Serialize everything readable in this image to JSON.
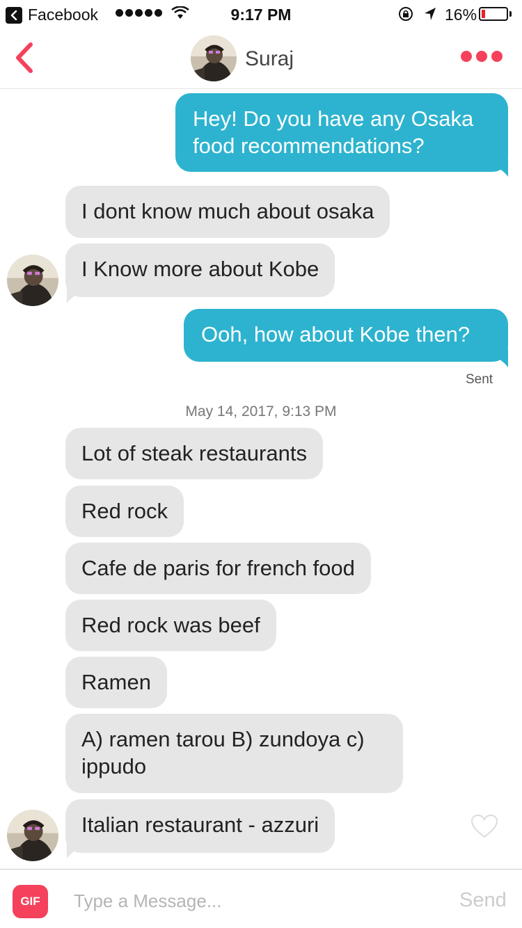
{
  "status_bar": {
    "back_app": "Facebook",
    "time": "9:17 PM",
    "battery_pct": "16%",
    "battery_level": 0.16,
    "signal_dots": 5
  },
  "nav": {
    "contact_name": "Suraj"
  },
  "messages": [
    {
      "dir": "sent",
      "text": "Hey! Do you have any Osaka\nfood recommendations?"
    },
    {
      "dir": "recv",
      "text": "I dont know much about osaka"
    },
    {
      "dir": "recv",
      "text": "I Know more about Kobe"
    },
    {
      "dir": "sent",
      "text": "Ooh, how about Kobe then?"
    },
    {
      "dir": "recv",
      "text": "Lot of steak restaurants"
    },
    {
      "dir": "recv",
      "text": "Red rock"
    },
    {
      "dir": "recv",
      "text": "Cafe de paris for french food"
    },
    {
      "dir": "recv",
      "text": "Red rock was beef"
    },
    {
      "dir": "recv",
      "text": "Ramen"
    },
    {
      "dir": "recv",
      "text": "A) ramen tarou B) zundoya c)\nippudo"
    },
    {
      "dir": "recv",
      "text": "Italian restaurant - azzuri"
    }
  ],
  "sent_status": "Sent",
  "timestamp": "May 14, 2017, 9:13 PM",
  "composer": {
    "gif_label": "GIF",
    "placeholder": "Type a Message...",
    "send_label": "Send"
  },
  "colors": {
    "accent": "#f5415b",
    "sent_bubble": "#2db3cf",
    "received_bubble": "#e6e6e6"
  }
}
